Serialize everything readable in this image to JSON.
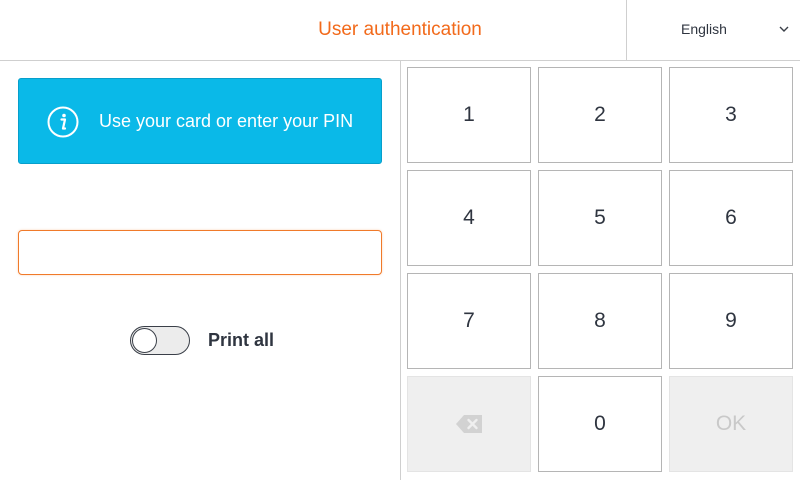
{
  "header": {
    "title": "User authentication",
    "language": {
      "selected": "English",
      "icon": "chevron-down-icon"
    }
  },
  "info": {
    "icon": "info-icon",
    "message": "Use your card or enter your PIN",
    "color": "#0ab9e8"
  },
  "pin_input": {
    "value": "",
    "placeholder": ""
  },
  "print_all": {
    "label": "Print all",
    "state": "off"
  },
  "keypad": {
    "keys": [
      {
        "label": "1",
        "enabled": true
      },
      {
        "label": "2",
        "enabled": true
      },
      {
        "label": "3",
        "enabled": true
      },
      {
        "label": "4",
        "enabled": true
      },
      {
        "label": "5",
        "enabled": true
      },
      {
        "label": "6",
        "enabled": true
      },
      {
        "label": "7",
        "enabled": true
      },
      {
        "label": "8",
        "enabled": true
      },
      {
        "label": "9",
        "enabled": true
      },
      {
        "label": "",
        "icon": "backspace-icon",
        "enabled": false
      },
      {
        "label": "0",
        "enabled": true
      },
      {
        "label": "OK",
        "enabled": false
      }
    ]
  },
  "colors": {
    "accent": "#f26a1b",
    "info": "#0ab9e8",
    "disabled_key": "#efefef"
  }
}
